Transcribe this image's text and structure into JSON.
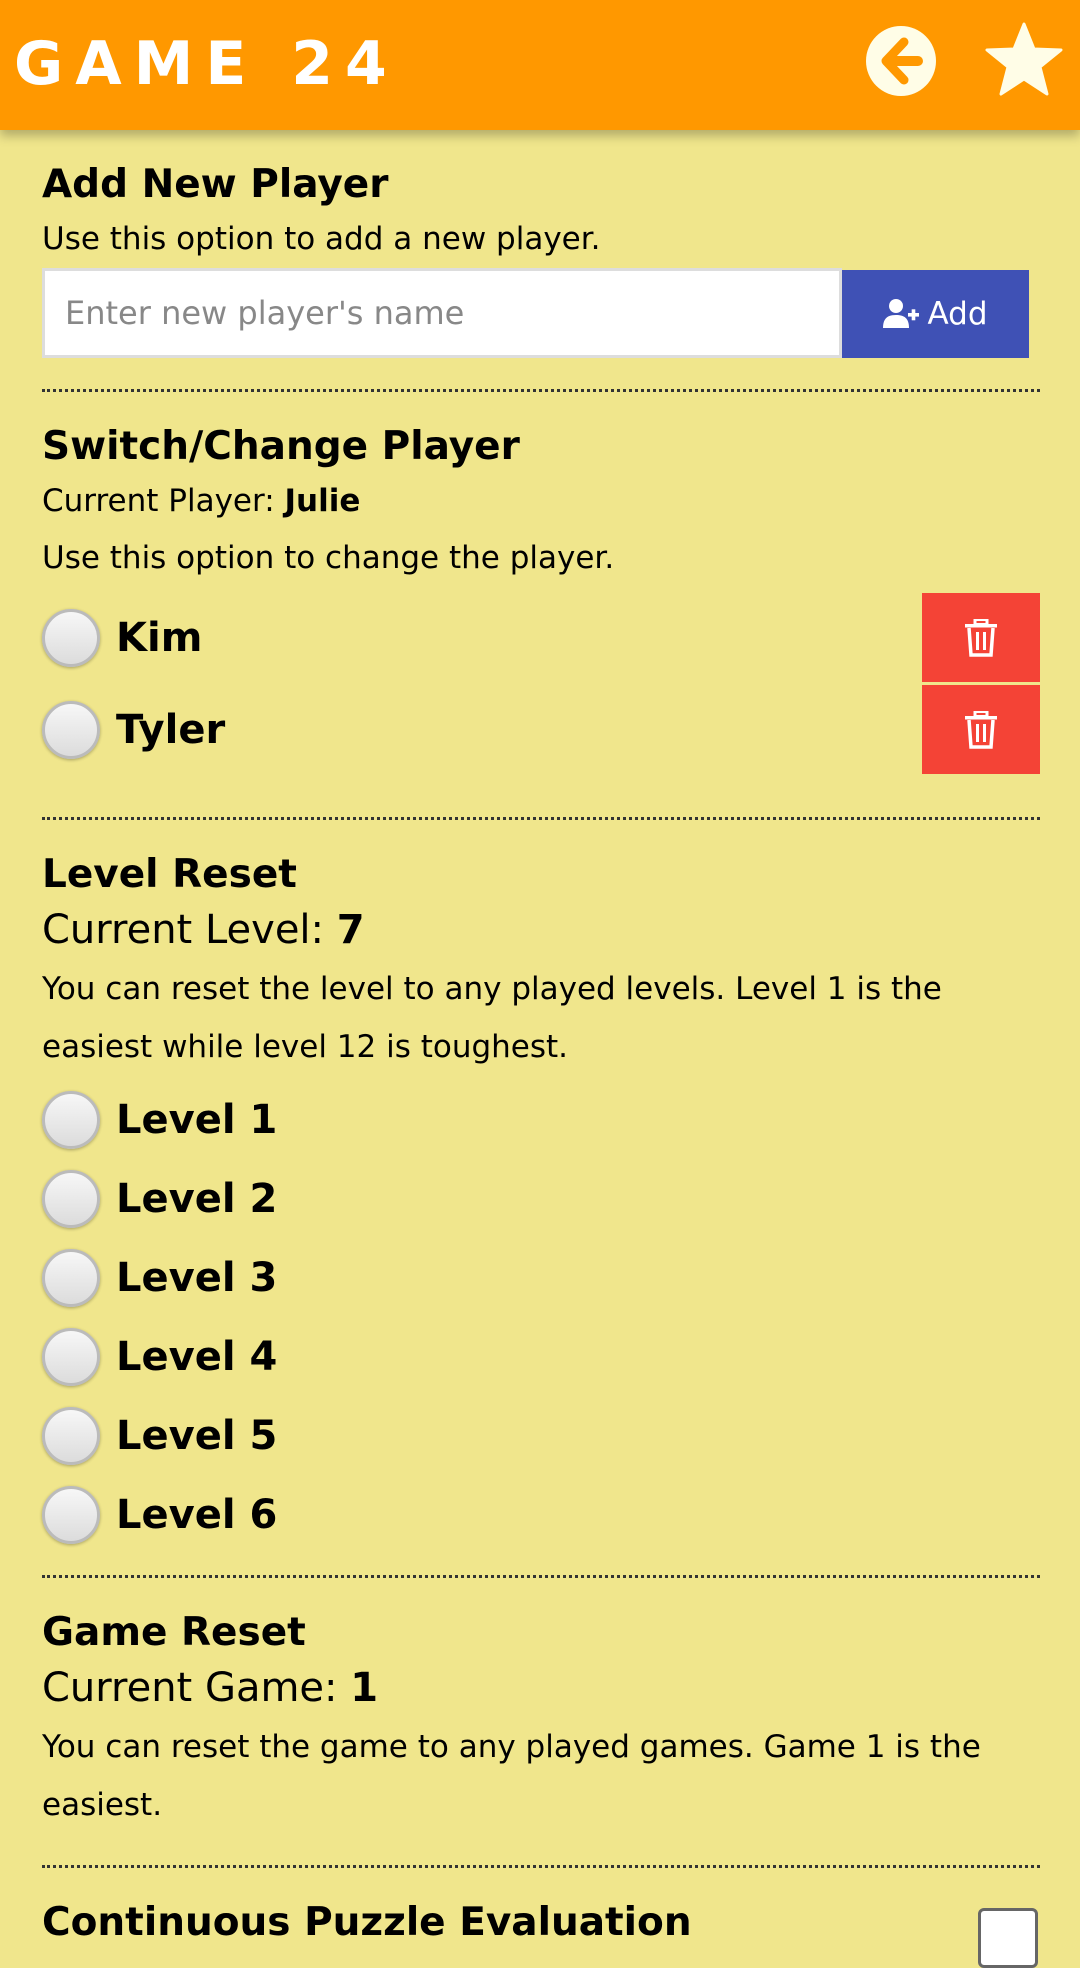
{
  "app": {
    "title": "GAME 24",
    "colors": {
      "app_bar": "#ff9800",
      "background": "#f0e68c",
      "add_button": "#3f51b5",
      "delete_button": "#f44336"
    },
    "icons": {
      "back": "arrow-left-circle-icon",
      "favorite": "star-icon"
    }
  },
  "add_player": {
    "heading": "Add New Player",
    "description": "Use this option to add a new player.",
    "input_placeholder": "Enter new player's name",
    "input_value": "",
    "button_label": "Add",
    "button_icon": "user-plus-icon"
  },
  "switch_player": {
    "heading": "Switch/Change Player",
    "current_label": "Current Player: ",
    "current_value": "Julie",
    "description": "Use this option to change the player.",
    "players": [
      {
        "name": "Kim",
        "delete_icon": "trash-icon"
      },
      {
        "name": "Tyler",
        "delete_icon": "trash-icon"
      }
    ]
  },
  "level_reset": {
    "heading": "Level Reset",
    "current_label": "Current Level: ",
    "current_value": "7",
    "description": "You can reset the level to any played levels. Level 1 is the easiest while level 12 is toughest.",
    "levels": [
      "Level 1",
      "Level 2",
      "Level 3",
      "Level 4",
      "Level 5",
      "Level 6"
    ]
  },
  "game_reset": {
    "heading": "Game Reset",
    "current_label": "Current Game: ",
    "current_value": "1",
    "description": "You can reset the game to any played games. Game 1 is the easiest."
  },
  "continuous": {
    "heading": "Continuous Puzzle Evaluation"
  }
}
